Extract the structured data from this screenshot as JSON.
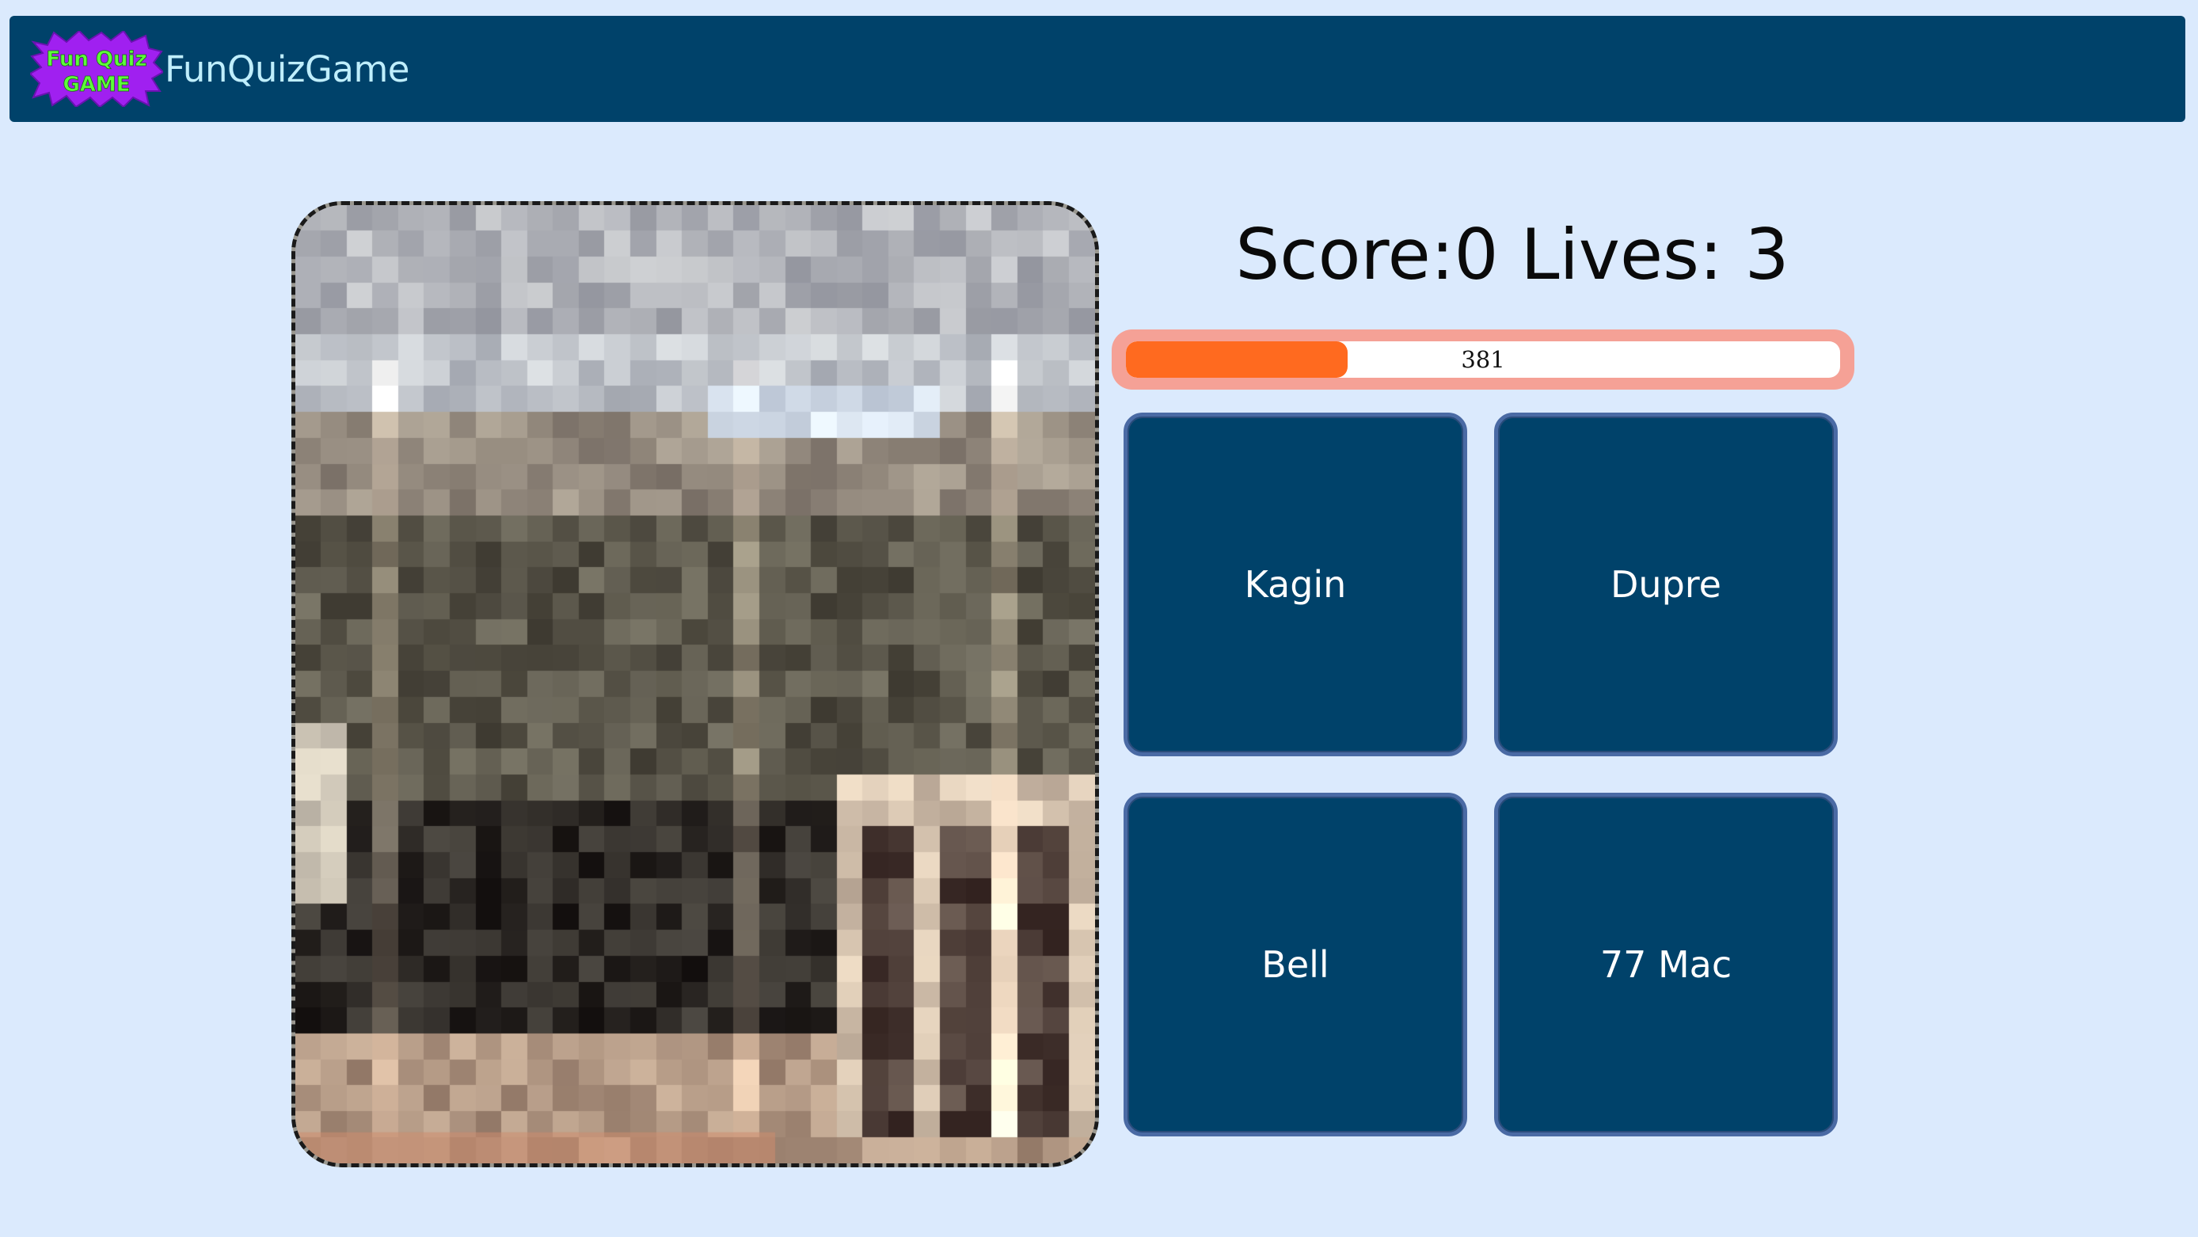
{
  "header": {
    "logo_line1": "Fun Quiz",
    "logo_line2": "GAME",
    "title": "FunQuizGame"
  },
  "status": {
    "score_label": "Score:",
    "score": "0",
    "lives_label": "Lives:",
    "lives": "3"
  },
  "timer": {
    "value": "381",
    "fill_fraction": 0.31
  },
  "answers": [
    {
      "label": "Kagin"
    },
    {
      "label": "Dupre"
    },
    {
      "label": "Bell"
    },
    {
      "label": "77 Mac"
    }
  ],
  "colors": {
    "background": "#dbeafd",
    "header": "#00426a",
    "title": "#bfeefc",
    "button": "#00426a",
    "button_border": "#4a6aa4",
    "timer_outer": "#f5a196",
    "timer_fill": "#ff6a1f",
    "logo_burst": "#a020f0",
    "logo_text": "#5dff3a"
  }
}
